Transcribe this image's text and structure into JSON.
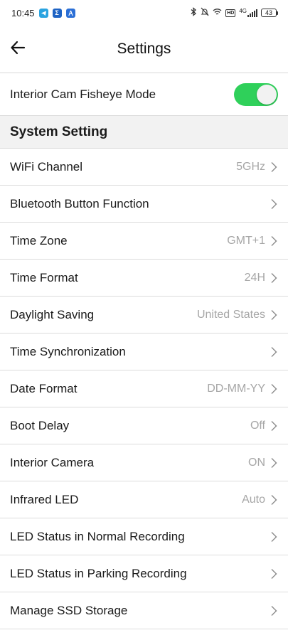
{
  "status_bar": {
    "time": "10:45",
    "network": "4G",
    "battery": "43",
    "hd_badge": "HD"
  },
  "header": {
    "title": "Settings",
    "back_icon": "arrow-left-icon"
  },
  "fisheye": {
    "label": "Interior Cam Fisheye Mode",
    "enabled": true
  },
  "section": {
    "title": "System Setting"
  },
  "rows": [
    {
      "label": "WiFi Channel",
      "value": "5GHz"
    },
    {
      "label": "Bluetooth Button Function",
      "value": ""
    },
    {
      "label": "Time Zone",
      "value": "GMT+1"
    },
    {
      "label": "Time Format",
      "value": "24H"
    },
    {
      "label": "Daylight Saving",
      "value": "United States"
    },
    {
      "label": "Time Synchronization",
      "value": ""
    },
    {
      "label": "Date Format",
      "value": "DD-MM-YY"
    },
    {
      "label": "Boot Delay",
      "value": "Off"
    },
    {
      "label": "Interior Camera",
      "value": "ON"
    },
    {
      "label": "Infrared LED",
      "value": "Auto"
    },
    {
      "label": "LED Status in Normal Recording",
      "value": ""
    },
    {
      "label": "LED Status in Parking Recording",
      "value": ""
    },
    {
      "label": "Manage SSD Storage",
      "value": ""
    }
  ],
  "colors": {
    "toggle_on": "#2fd05a",
    "value_text": "#a6a6a6",
    "section_bg": "#f2f2f2"
  }
}
